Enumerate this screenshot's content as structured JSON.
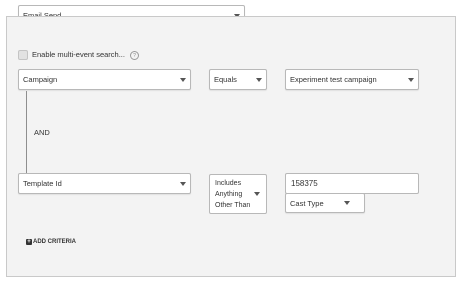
{
  "event_select": {
    "value": "Email Send"
  },
  "multi_event": {
    "label": "Enable multi-event search...",
    "info_icon": "?"
  },
  "criteria": [
    {
      "field": "Campaign",
      "operator": "Equals",
      "value": "Experiment test campaign"
    },
    {
      "field": "Template Id",
      "operator_lines": [
        "Includes",
        "Anything",
        "Other Than"
      ],
      "value": "158375",
      "cast_type": "Cast Type"
    }
  ],
  "connector": "AND",
  "add_criteria": {
    "icon": "+",
    "label": "ADD CRITERIA"
  },
  "colors": {
    "panel_bg": "#f3f3f3",
    "border": "#b8b8b8",
    "text": "#333333"
  }
}
